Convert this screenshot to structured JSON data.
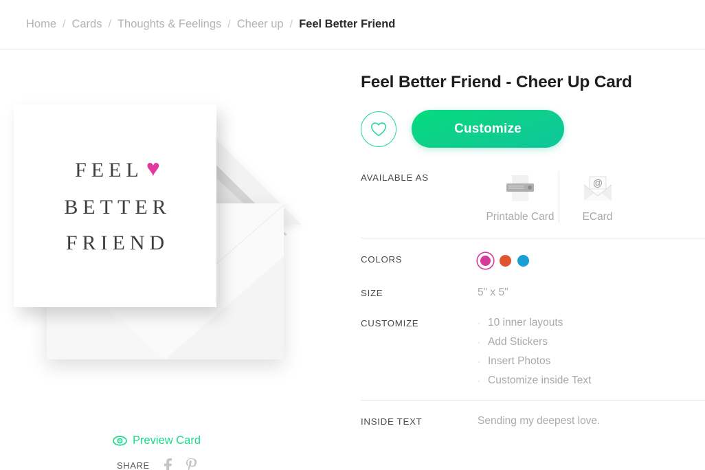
{
  "breadcrumb": {
    "items": [
      {
        "label": "Home",
        "current": false
      },
      {
        "label": "Cards",
        "current": false
      },
      {
        "label": "Thoughts & Feelings",
        "current": false
      },
      {
        "label": "Cheer up",
        "current": false
      },
      {
        "label": "Feel Better Friend",
        "current": true
      }
    ],
    "separator": "/"
  },
  "product": {
    "title": "Feel Better Friend - Cheer Up Card",
    "customize_label": "Customize",
    "favorite_icon": "heart-outline-icon"
  },
  "card_art": {
    "line1": "FEEL",
    "heart": "♥",
    "line2": "BETTER",
    "line3": "FRIEND",
    "heart_color": "#e0399f"
  },
  "preview": {
    "label": "Preview Card",
    "icon": "eye-icon",
    "color": "#19d98a"
  },
  "share": {
    "label": "SHARE",
    "networks": [
      {
        "name": "facebook",
        "glyph": "f"
      },
      {
        "name": "pinterest",
        "glyph": "P"
      }
    ]
  },
  "specs": {
    "available_as": {
      "label": "AVAILABLE AS",
      "options": [
        {
          "name": "Printable Card",
          "icon": "printer-icon"
        },
        {
          "name": "ECard",
          "icon": "email-envelope-icon"
        }
      ]
    },
    "colors": {
      "label": "COLORS",
      "swatches": [
        {
          "name": "pink",
          "hex": "#d6399b",
          "selected": true
        },
        {
          "name": "orange",
          "hex": "#e0552f",
          "selected": false
        },
        {
          "name": "blue",
          "hex": "#1a9fd4",
          "selected": false
        }
      ]
    },
    "size": {
      "label": "SIZE",
      "value": "5\" x 5\""
    },
    "customize": {
      "label": "CUSTOMIZE",
      "bullet": "·",
      "items": [
        "10 inner layouts",
        "Add Stickers",
        "Insert Photos",
        "Customize inside Text"
      ]
    },
    "inside_text": {
      "label": "INSIDE TEXT",
      "value": "Sending my deepest love."
    }
  }
}
